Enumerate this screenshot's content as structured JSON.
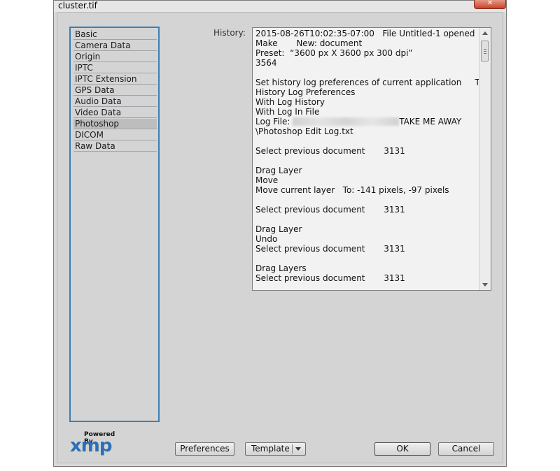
{
  "window": {
    "title": "cluster.tif",
    "close_icon": "close-icon"
  },
  "sidebar": {
    "items": [
      {
        "label": "Basic",
        "selected": false
      },
      {
        "label": "Camera Data",
        "selected": false
      },
      {
        "label": "Origin",
        "selected": false
      },
      {
        "label": "IPTC",
        "selected": false
      },
      {
        "label": "IPTC Extension",
        "selected": false
      },
      {
        "label": "GPS Data",
        "selected": false
      },
      {
        "label": "Audio Data",
        "selected": false
      },
      {
        "label": "Video Data",
        "selected": false
      },
      {
        "label": "Photoshop",
        "selected": true
      },
      {
        "label": "DICOM",
        "selected": false
      },
      {
        "label": "Raw Data",
        "selected": false
      }
    ]
  },
  "history": {
    "label": "History:",
    "lines": [
      "2015-08-26T10:02:35-07:00   File Untitled-1 opened",
      "Make       New: document",
      "Preset:  “3600 px X 3600 px 300 dpi”",
      "3564",
      "",
      "Set history log preferences of current application     To:",
      "History Log Preferences",
      "With Log History",
      "With Log In File",
      "Log File: ",
      "\\Photoshop Edit Log.txt",
      "",
      "Select previous document       3131",
      "",
      "Drag Layer",
      "Move",
      "Move current layer   To: -141 pixels, -97 pixels",
      "",
      "Select previous document       3131",
      "",
      "Drag Layer",
      "Undo",
      "Select previous document       3131",
      "",
      "Drag Layers",
      "Select previous document       3131"
    ],
    "log_file_suffix": "TAKE ME AWAY"
  },
  "logo": {
    "powered_by": "Powered By",
    "brand": "xmp"
  },
  "buttons": {
    "preferences": "Preferences",
    "template": "Template",
    "ok": "OK",
    "cancel": "Cancel"
  }
}
